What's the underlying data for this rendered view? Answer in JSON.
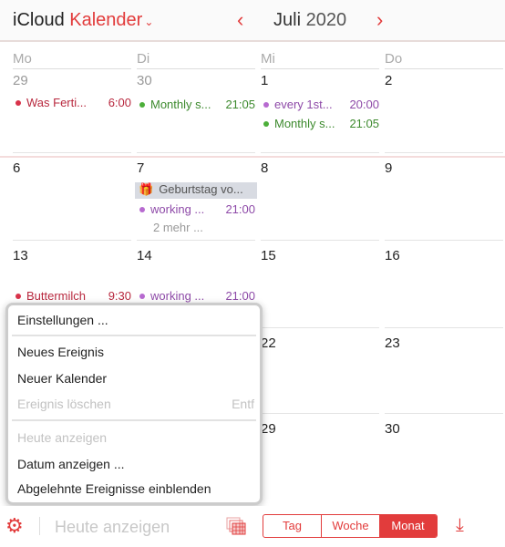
{
  "header": {
    "app_name": "iCloud",
    "app_section": "Kalender",
    "month": "Juli",
    "year": "2020",
    "prev_icon": "chevron-left-icon",
    "next_icon": "chevron-right-icon"
  },
  "weekdays": [
    "Mo",
    "Di",
    "Mi",
    "Do"
  ],
  "weeks": [
    {
      "days": [
        "29",
        "30",
        "1",
        "2"
      ]
    },
    {
      "days": [
        "6",
        "7",
        "8",
        "9"
      ]
    },
    {
      "days": [
        "13",
        "14",
        "15",
        "16"
      ]
    },
    {
      "days": [
        "",
        "",
        "22",
        "23"
      ]
    },
    {
      "days": [
        "",
        "",
        "29",
        "30"
      ]
    }
  ],
  "events": {
    "mo29": {
      "title": "Was Ferti...",
      "time": "6:00",
      "color": "#d8324a"
    },
    "di30": {
      "title": "Monthly s...",
      "time": "21:05",
      "color": "#4caf3a"
    },
    "mi1a": {
      "title": "every 1st...",
      "time": "20:00",
      "color": "#b76ad0"
    },
    "mi1b": {
      "title": "Monthly s...",
      "time": "21:05",
      "color": "#4caf3a"
    },
    "di7_bday": {
      "title": "Geburtstag vo...",
      "icon": "gift-icon"
    },
    "di7": {
      "title": "working ...",
      "time": "21:00",
      "color": "#b76ad0"
    },
    "di7_more": "2 mehr ...",
    "mo13": {
      "title": "Buttermilch",
      "time": "9:30",
      "color": "#d8324a"
    },
    "di14": {
      "title": "working ...",
      "time": "21:00",
      "color": "#b76ad0"
    }
  },
  "menu": {
    "settings": "Einstellungen ...",
    "new_event": "Neues Ereignis",
    "new_calendar": "Neuer Kalender",
    "delete_event": "Ereignis löschen",
    "delete_shortcut": "Entf",
    "show_today": "Heute anzeigen",
    "show_date": "Datum anzeigen ...",
    "show_declined": "Abgelehnte Ereignisse einblenden"
  },
  "toolbar": {
    "today": "Heute anzeigen",
    "views": [
      "Tag",
      "Woche",
      "Monat"
    ],
    "active_view": "Monat"
  },
  "colors": {
    "accent": "#e23c3c"
  }
}
